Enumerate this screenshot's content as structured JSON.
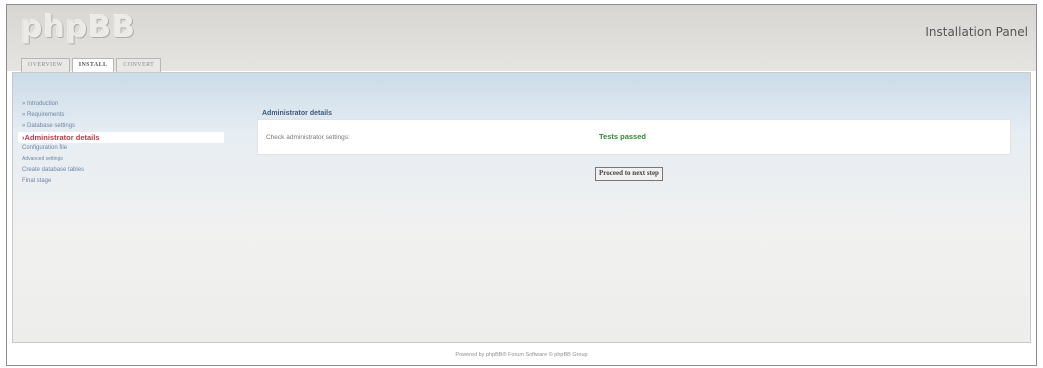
{
  "app": {
    "logo": "phpBB",
    "panel_title": "Installation Panel"
  },
  "tabs": [
    {
      "label": "OVERVIEW",
      "active": false
    },
    {
      "label": "INSTALL",
      "active": true
    },
    {
      "label": "CONVERT",
      "active": false
    }
  ],
  "sidebar": {
    "items": [
      {
        "label": "» Introduction",
        "state": "done"
      },
      {
        "label": "» Requirements",
        "state": "done"
      },
      {
        "label": "» Database settings",
        "state": "done"
      },
      {
        "label": "›Administrator details",
        "state": "current"
      },
      {
        "label": "Configuration file",
        "state": "pending"
      },
      {
        "label": "Advanced settings",
        "state": "pending"
      },
      {
        "label": "Create database tables",
        "state": "pending"
      },
      {
        "label": "Final stage",
        "state": "pending"
      }
    ]
  },
  "main": {
    "legend": "Administrator details",
    "check_label": "Check administrator settings:",
    "result": "Tests passed",
    "proceed_button": "Proceed to next step"
  },
  "footer": {
    "text": "Powered by phpBB® Forum Software © phpBB Group"
  },
  "colors": {
    "current_step": "#c2344a",
    "passed": "#2e8a37",
    "link": "#6d86a4"
  }
}
